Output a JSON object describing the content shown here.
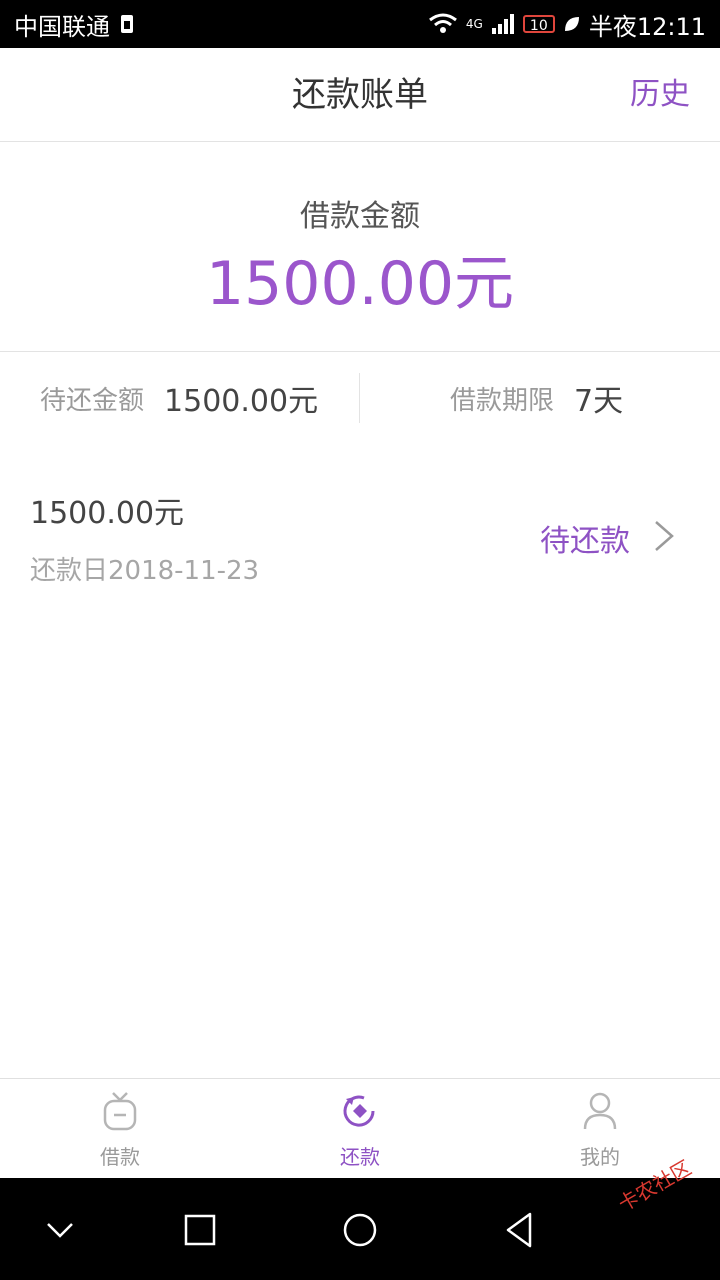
{
  "status_bar": {
    "carrier": "中国联通",
    "network": "4G",
    "battery": "10",
    "time": "半夜12:11"
  },
  "header": {
    "title": "还款账单",
    "history_label": "历史"
  },
  "loan": {
    "label": "借款金额",
    "amount": "1500.00元"
  },
  "info": {
    "pending_label": "待还金额",
    "pending_value": "1500.00元",
    "term_label": "借款期限",
    "term_value": "7天"
  },
  "bills": [
    {
      "amount": "1500.00元",
      "due_date": "还款日2018-11-23",
      "status": "待还款"
    }
  ],
  "tabs": [
    {
      "label": "借款",
      "icon": "bag-icon",
      "active": false
    },
    {
      "label": "还款",
      "icon": "repay-icon",
      "active": true
    },
    {
      "label": "我的",
      "icon": "user-icon",
      "active": false
    }
  ],
  "watermark": "卡农社区",
  "colors": {
    "accent": "#8e52c4",
    "amount": "#9b56cc"
  }
}
